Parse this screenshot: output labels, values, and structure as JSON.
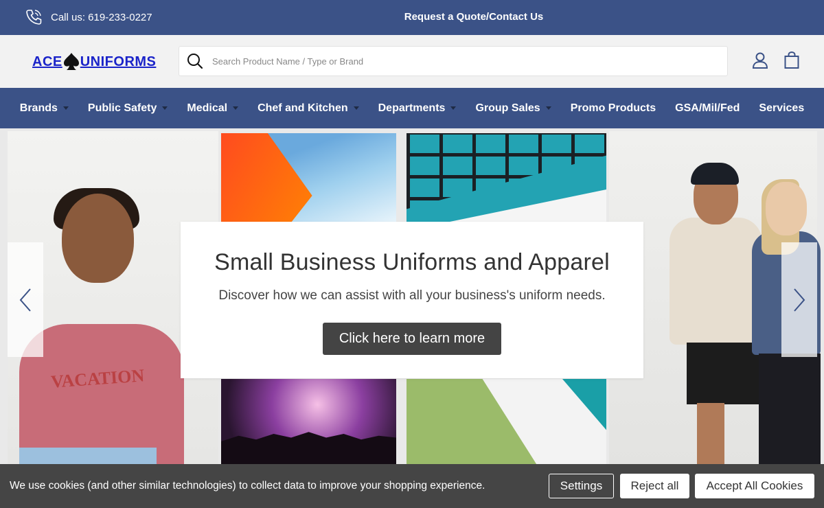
{
  "topbar": {
    "phone_label": "Call us: 619-233-0227",
    "quote_link": "Request a Quote/Contact Us"
  },
  "header": {
    "logo_left": "ACE",
    "logo_right": "UNIFORMS",
    "search_placeholder": "Search Product Name / Type or Brand"
  },
  "nav": {
    "items": [
      {
        "label": "Brands",
        "has_dropdown": true
      },
      {
        "label": "Public Safety",
        "has_dropdown": true
      },
      {
        "label": "Medical",
        "has_dropdown": true
      },
      {
        "label": "Chef and Kitchen",
        "has_dropdown": true
      },
      {
        "label": "Departments",
        "has_dropdown": true
      },
      {
        "label": "Group Sales",
        "has_dropdown": true
      },
      {
        "label": "Promo Products",
        "has_dropdown": false
      },
      {
        "label": "GSA/Mil/Fed",
        "has_dropdown": false
      },
      {
        "label": "Services",
        "has_dropdown": false
      }
    ]
  },
  "hero": {
    "title": "Small Business Uniforms and Apparel",
    "subtitle": "Discover how we can assist with all your business's uniform needs.",
    "cta": "Click here to learn more",
    "sweater_text": "VACATION"
  },
  "cookie": {
    "message": "We use cookies (and other similar technologies) to collect data to improve your shopping experience.",
    "settings": "Settings",
    "reject": "Reject all",
    "accept": "Accept All Cookies"
  },
  "colors": {
    "brand_blue": "#3b5287",
    "logo_blue": "#1a23c9",
    "cookie_bg": "#454545",
    "cta_bg": "#444444"
  }
}
